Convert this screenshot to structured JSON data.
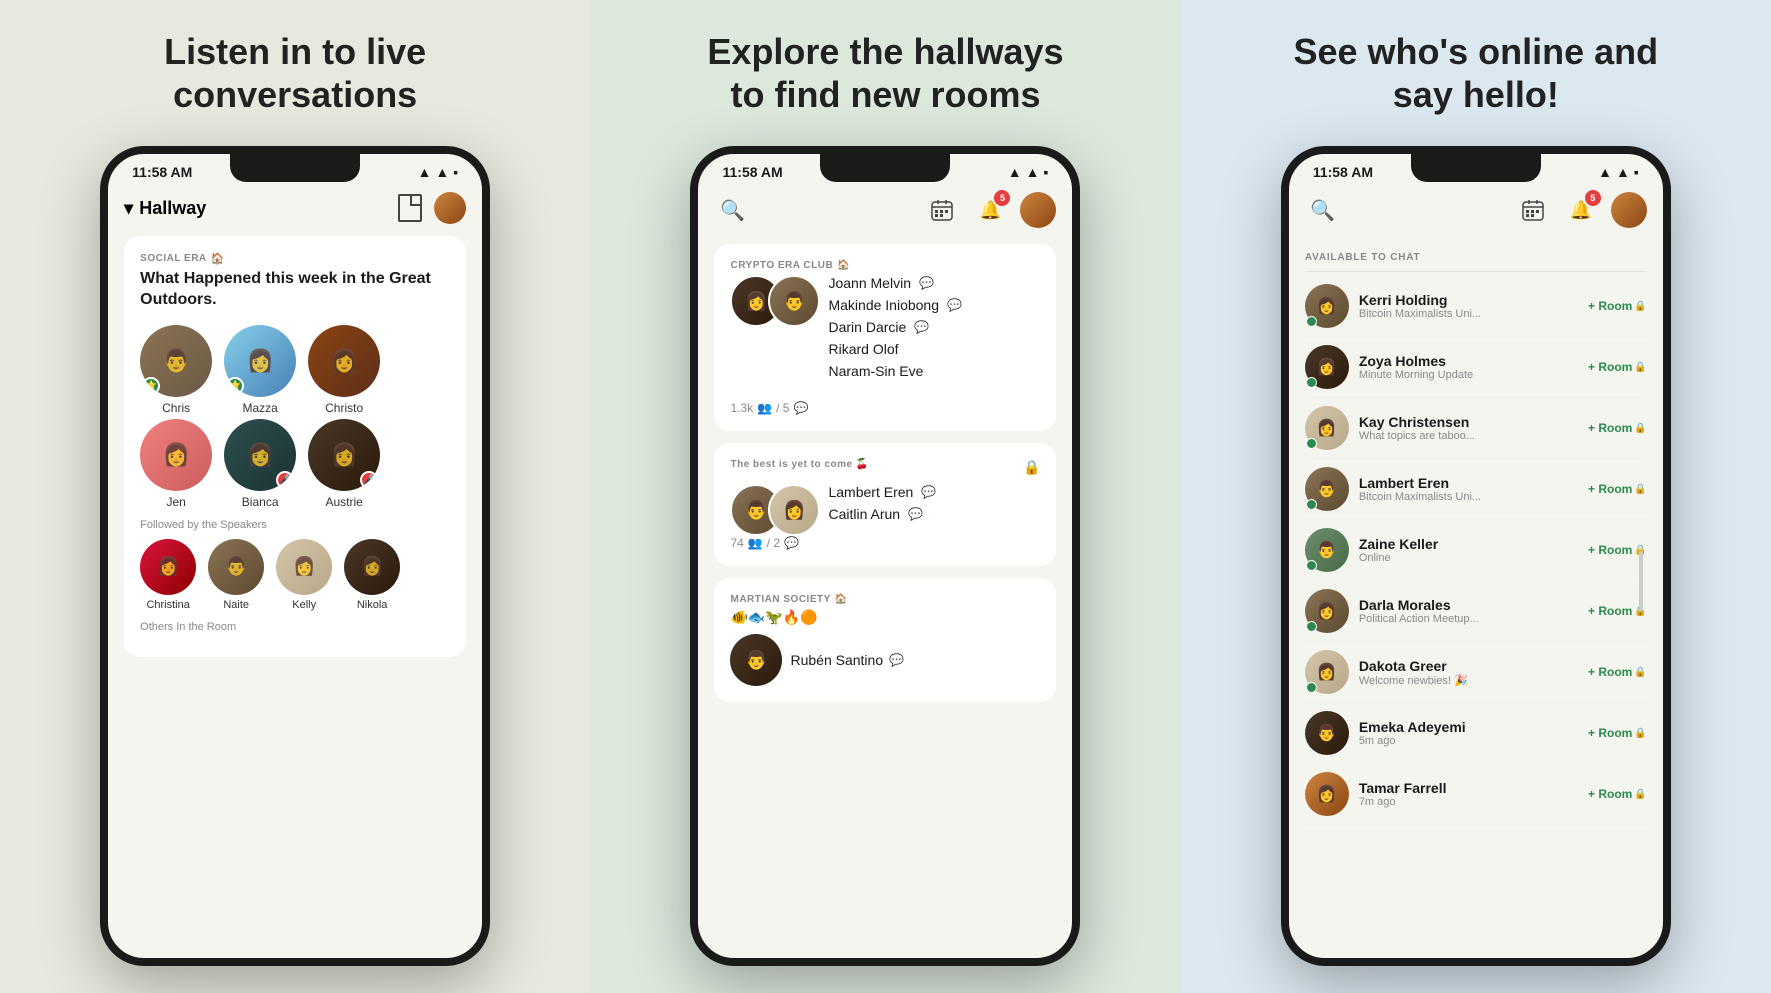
{
  "panel1": {
    "title": "Listen in to live conversations",
    "phone": {
      "time": "11:58 AM",
      "header": {
        "title": "Hallway",
        "chevron": "▾"
      },
      "room": {
        "label": "SOCIAL ERA",
        "title": "What Happened this week in the Great Outdoors.",
        "speakers": [
          {
            "name": "Chris",
            "avatar": "av-chris",
            "online": true
          },
          {
            "name": "Mazza",
            "avatar": "av-mazza",
            "online": true
          },
          {
            "name": "Christo",
            "avatar": "av-christo",
            "online": false
          }
        ],
        "row2": [
          {
            "name": "Jen",
            "avatar": "av-jen",
            "muted": false
          },
          {
            "name": "Bianca",
            "avatar": "av-bianca",
            "muted": true
          },
          {
            "name": "Austrie",
            "avatar": "av-austrie",
            "muted": true
          }
        ],
        "followed_label": "Followed by the Speakers",
        "listeners": [
          {
            "name": "Christina",
            "avatar": "av-christina"
          },
          {
            "name": "Naite",
            "avatar": "av-naite"
          },
          {
            "name": "Kelly",
            "avatar": "av-kelly"
          },
          {
            "name": "Nikola",
            "avatar": "av-nikola"
          }
        ],
        "others_label": "Others In the Room"
      }
    }
  },
  "panel2": {
    "title": "Explore the hallways to find new rooms",
    "phone": {
      "time": "11:58 AM",
      "notif_count": "5",
      "rooms": [
        {
          "label": "CRYPTO ERA CLUB",
          "speakers": [
            {
              "name": "Joann Melvin",
              "chat": true
            },
            {
              "name": "Makinde Iniobong",
              "chat": true
            },
            {
              "name": "Darin Darcie",
              "chat": true
            },
            {
              "name": "Rikard Olof",
              "chat": false
            },
            {
              "name": "Naram-Sin Eve",
              "chat": false
            }
          ],
          "stats": "1.3k",
          "comments": "5",
          "locked": false
        },
        {
          "label": "The best is yet to come 🍒",
          "locked": true,
          "speakers": [
            {
              "name": "Lambert Eren",
              "chat": true
            },
            {
              "name": "Caitlin Arun",
              "chat": true
            }
          ],
          "stats": "74",
          "comments": "2"
        },
        {
          "label": "MARTIAN SOCIETY",
          "emojis": "🐠🐟🦖🔥🟠",
          "speakers": [
            {
              "name": "Rubén Santino",
              "chat": true
            }
          ],
          "locked": false
        }
      ]
    }
  },
  "panel3": {
    "title": "See who's online and say hello!",
    "phone": {
      "time": "11:58 AM",
      "notif_count": "5",
      "available_label": "AVAILABLE TO CHAT",
      "people": [
        {
          "name": "Kerri Holding",
          "sub": "Bitcoin Maximalists Uni...",
          "online": true,
          "avatar": "av3-kerri"
        },
        {
          "name": "Zoya Holmes",
          "sub": "Minute Morning Update",
          "online": true,
          "avatar": "av3-zoya"
        },
        {
          "name": "Kay Christensen",
          "sub": "What topics are taboo...",
          "online": true,
          "avatar": "av3-kay"
        },
        {
          "name": "Lambert Eren",
          "sub": "Bitcoin Maximalists Uni...",
          "online": true,
          "avatar": "av3-lambert"
        },
        {
          "name": "Zaine Keller",
          "sub": "Online",
          "online": true,
          "avatar": "av3-zaine"
        },
        {
          "name": "Darla Morales",
          "sub": "Political Action Meetup...",
          "online": true,
          "avatar": "av3-darla"
        },
        {
          "name": "Dakota Greer",
          "sub": "Welcome newbies! 🎉",
          "online": true,
          "avatar": "av3-dakota"
        },
        {
          "name": "Emeka Adeyemi",
          "sub": "5m ago",
          "online": false,
          "avatar": "av3-emeka"
        },
        {
          "name": "Tamar Farrell",
          "sub": "7m ago",
          "online": false,
          "avatar": "av3-tamar"
        }
      ],
      "room_label": "+ Room"
    }
  }
}
